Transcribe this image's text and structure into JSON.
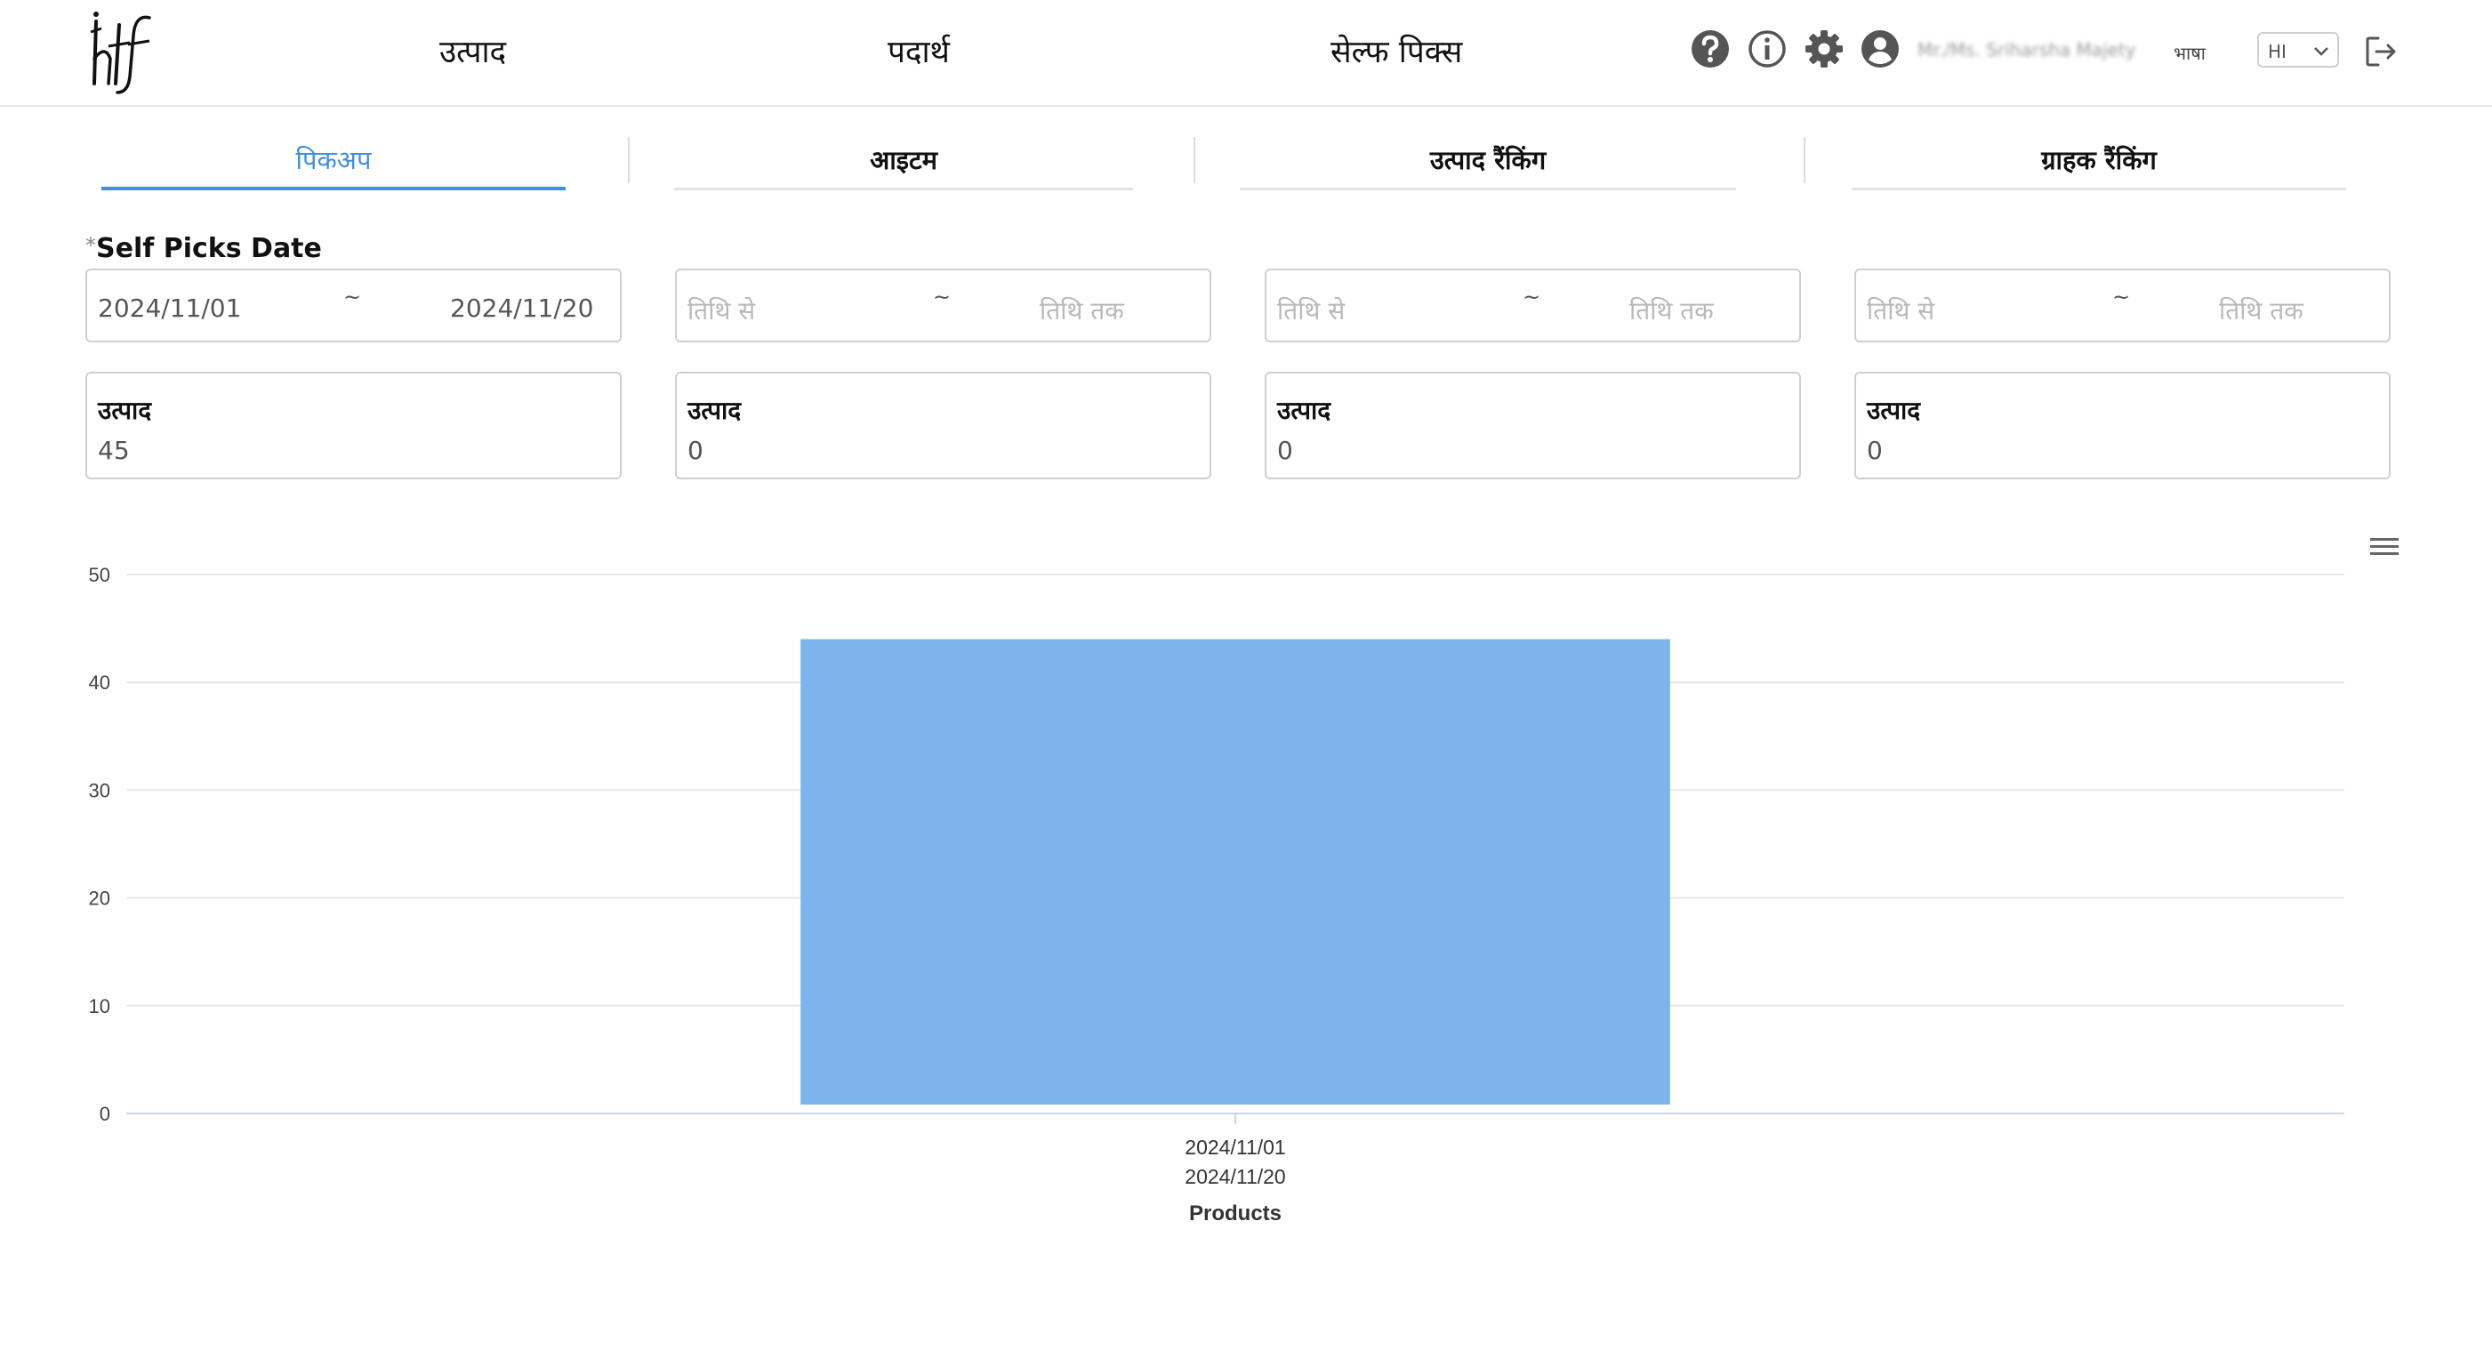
{
  "header": {
    "logo_text": "htf",
    "nav": [
      "उत्पाद",
      "पदार्थ",
      "सेल्फ पिक्स"
    ],
    "icons": [
      "help-icon",
      "info-icon",
      "settings-icon",
      "user-icon",
      "logout-icon"
    ],
    "user_name": "Mr./Ms. Sriharsha Majety",
    "language_label": "भाषा",
    "language_value": "HI"
  },
  "tabs": [
    {
      "label": "पिकअप",
      "active": true
    },
    {
      "label": "आइटम",
      "active": false
    },
    {
      "label": "उत्पाद रैंकिंग",
      "active": false
    },
    {
      "label": "ग्राहक रैंकिंग",
      "active": false
    }
  ],
  "form": {
    "date_label": "Self Picks Date",
    "required_mark": "*",
    "range_separator": "~",
    "ranges": [
      {
        "from": "2024/11/01",
        "to": "2024/11/20",
        "from_placeholder": "तिथि से",
        "to_placeholder": "तिथि तक"
      },
      {
        "from": "",
        "to": "",
        "from_placeholder": "तिथि से",
        "to_placeholder": "तिथि तक"
      },
      {
        "from": "",
        "to": "",
        "from_placeholder": "तिथि से",
        "to_placeholder": "तिथि तक"
      },
      {
        "from": "",
        "to": "",
        "from_placeholder": "तिथि से",
        "to_placeholder": "तिथि तक"
      }
    ],
    "stats": [
      {
        "label": "उत्पाद",
        "value": "45"
      },
      {
        "label": "उत्पाद",
        "value": "0"
      },
      {
        "label": "उत्पाद",
        "value": "0"
      },
      {
        "label": "उत्पाद",
        "value": "0"
      }
    ]
  },
  "chart_data": {
    "type": "bar",
    "categories": [
      [
        "2024/11/01",
        "2024/11/20"
      ]
    ],
    "values": [
      44
    ],
    "xlabel": "Products",
    "ylabel": "",
    "ylim": [
      0,
      50
    ],
    "yticks": [
      0,
      10,
      20,
      30,
      40,
      50
    ],
    "grid": true,
    "bar_color": "#7cb4ec"
  },
  "colors": {
    "accent": "#3d8fe0",
    "bar": "#7cb4ec",
    "icon": "#555555"
  }
}
